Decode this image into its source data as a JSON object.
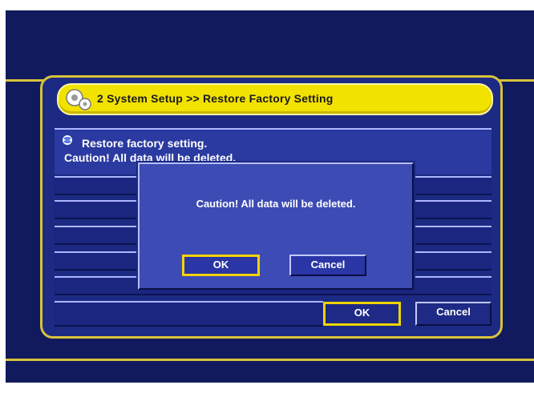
{
  "header": {
    "title": "2  System Setup >> Restore Factory Setting",
    "icon": "gears-icon"
  },
  "info": {
    "line1": "Restore factory setting.",
    "line2": "Caution! All data will be deleted."
  },
  "footer": {
    "ok_label": "OK",
    "cancel_label": "Cancel"
  },
  "dialog": {
    "message": "Caution! All data will be deleted.",
    "ok_label": "OK",
    "cancel_label": "Cancel",
    "selected": "OK"
  },
  "colors": {
    "background": "#121a5e",
    "accent": "#d8c23a",
    "titlebar": "#f2e200",
    "highlight": "#f2d400"
  }
}
